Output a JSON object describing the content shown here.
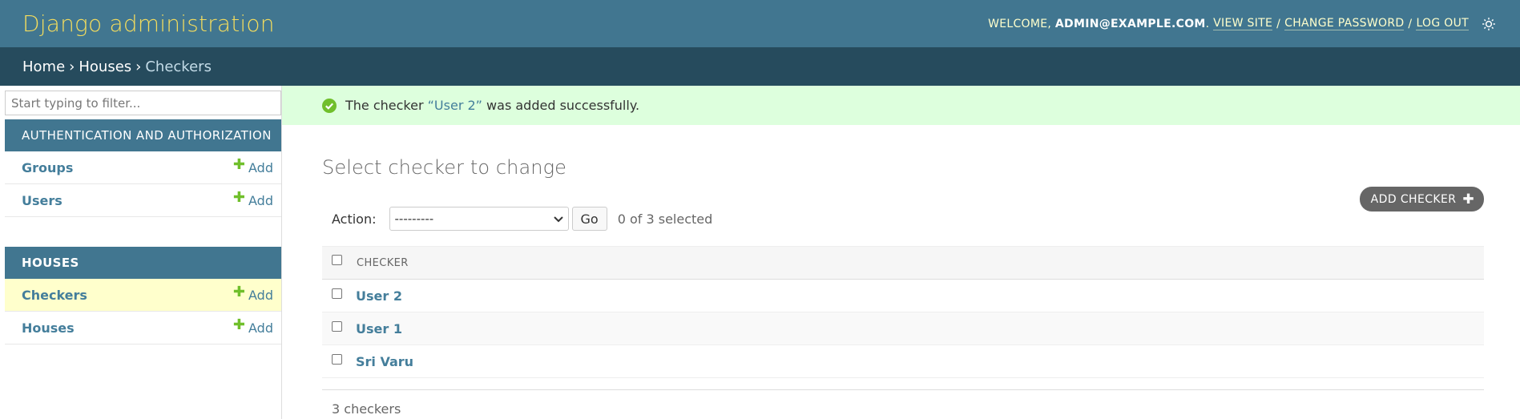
{
  "header": {
    "brand": "Django administration",
    "welcome": "WELCOME,",
    "username": "ADMIN@EXAMPLE.COM",
    "view_site": "VIEW SITE",
    "change_password": "CHANGE PASSWORD",
    "log_out": "LOG OUT",
    "separator": "/",
    "theme_icon": "sun-icon"
  },
  "breadcrumbs": {
    "home": "Home",
    "app": "Houses",
    "current": "Checkers",
    "separator": "›"
  },
  "sidebar": {
    "filter_placeholder": "Start typing to filter...",
    "modules": [
      {
        "caption": "AUTHENTICATION AND AUTHORIZATION",
        "rows": [
          {
            "label": "Groups",
            "add": "Add"
          },
          {
            "label": "Users",
            "add": "Add"
          }
        ]
      },
      {
        "caption": "HOUSES",
        "rows": [
          {
            "label": "Checkers",
            "add": "Add"
          },
          {
            "label": "Houses",
            "add": "Add"
          }
        ]
      }
    ]
  },
  "message": {
    "prefix": "The checker",
    "link": "“User 2”",
    "suffix": "was added successfully."
  },
  "main": {
    "title": "Select checker to change",
    "add_button": "ADD CHECKER",
    "action_label": "Action:",
    "action_value": "---------",
    "go_label": "Go",
    "selected_count": "0 of 3 selected",
    "column_header": "CHECKER",
    "rows": [
      "User 2",
      "User 1",
      "Sri Varu"
    ],
    "paginator": "3 checkers"
  },
  "colors": {
    "header_bg": "#417690",
    "breadcrumb_bg": "#264b5d",
    "brand": "#f5dd5d",
    "link": "#447e9b",
    "success_bg": "#ddffdd",
    "add_green": "#70bf2b",
    "current_row": "#ffffcc"
  }
}
